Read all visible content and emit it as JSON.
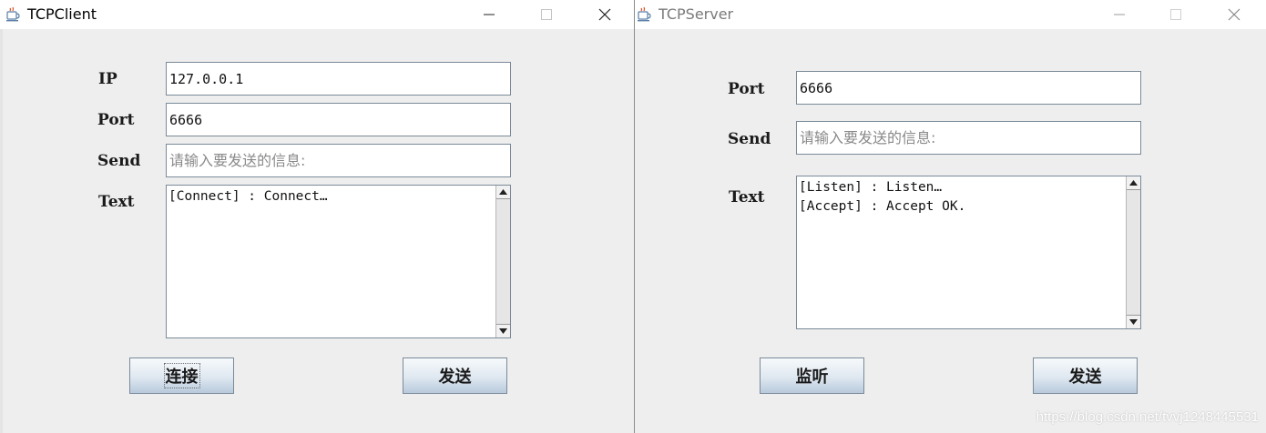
{
  "client": {
    "title": "TCPClient",
    "ip_label": "IP",
    "ip_value": "127.0.0.1",
    "port_label": "Port",
    "port_value": "6666",
    "send_label": "Send",
    "send_placeholder": "请输入要发送的信息:",
    "text_label": "Text",
    "text_lines": [
      "[Connect] : Connect…"
    ],
    "connect_button": "连接",
    "send_button": "发送"
  },
  "server": {
    "title": "TCPServer",
    "port_label": "Port",
    "port_value": "6666",
    "send_label": "Send",
    "send_placeholder": "请输入要发送的信息:",
    "text_label": "Text",
    "text_lines": [
      "[Listen] : Listen…",
      "[Accept] : Accept OK."
    ],
    "listen_button": "监听",
    "send_button": "发送"
  },
  "watermark": "https://blog.csdn.net/tvvj1248445531",
  "icons": {
    "app": "java-cup-icon",
    "minimize": "minimize-icon",
    "maximize": "maximize-icon",
    "close": "close-icon"
  },
  "colors": {
    "window_bg": "#eeeeee",
    "titlebar_bg": "#ffffff",
    "field_border": "#7a8a99",
    "button_top": "#f7f9fb",
    "button_bottom": "#b8cadc"
  }
}
